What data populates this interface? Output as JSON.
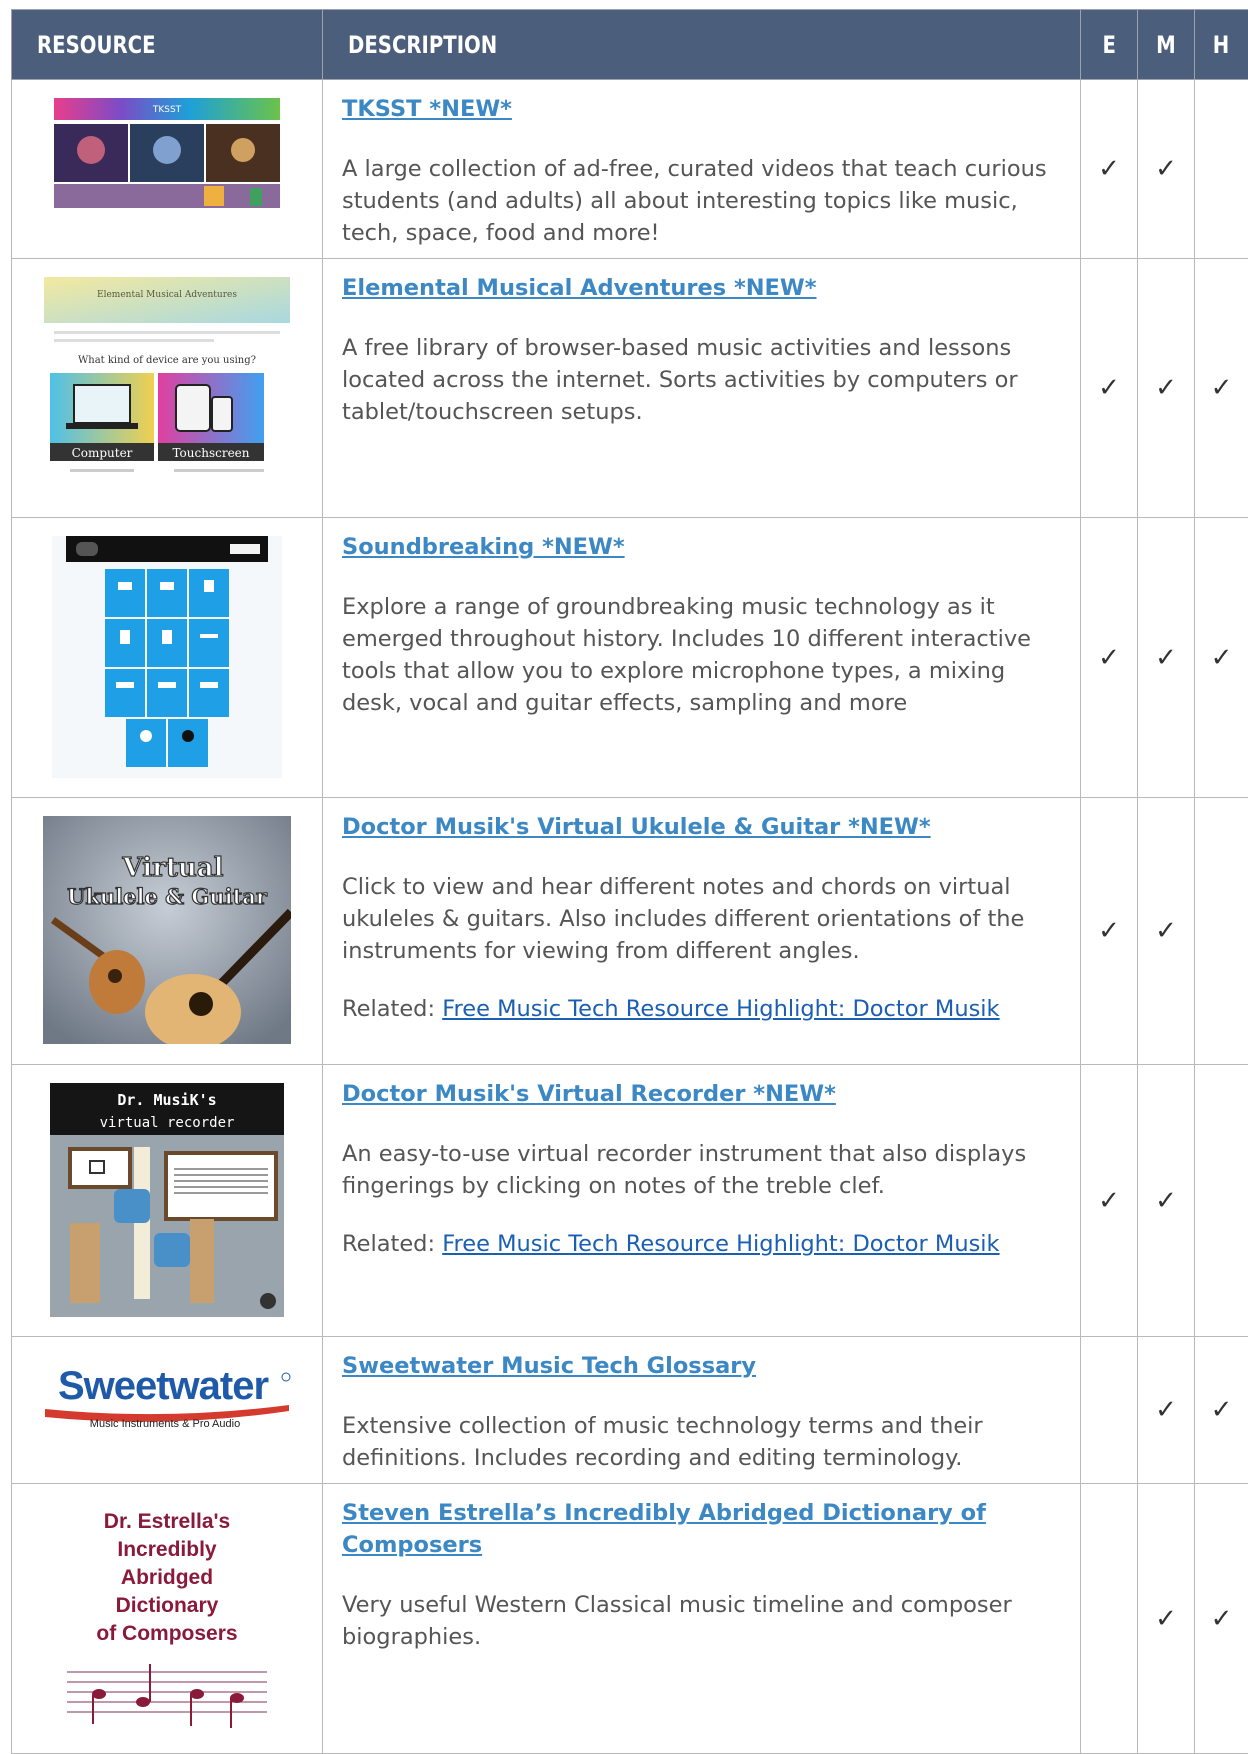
{
  "header": {
    "resource": "RESOURCE",
    "description": "DESCRIPTION",
    "e": "E",
    "m": "M",
    "h": "H"
  },
  "check_glyph": "✓",
  "colors": {
    "header_bg": "#4b5f7c",
    "link": "#3c88c4",
    "related_link": "#1a5fb4",
    "body_text": "#555555"
  },
  "rows": [
    {
      "title": "TKSST *NEW*",
      "description": "A large collection of ad-free, curated videos that teach curious students (and adults) all about interesting topics like music, tech, space, food and more!",
      "thumb_label": "TKSST",
      "thumb_icon": "tksst-thumbnail",
      "e": true,
      "m": true,
      "h": false
    },
    {
      "title": "Elemental Musical Adventures *NEW*",
      "description": "A free library of browser-based music activities and lessons located across the internet. Sorts activities by computers or tablet/touchscreen setups.",
      "thumb_label": "Elemental Musical Adventures",
      "thumb_question": "What kind of device are you using?",
      "thumb_btn1": "Computer",
      "thumb_btn2": "Touchscreen",
      "thumb_icon": "elemental-thumbnail",
      "e": true,
      "m": true,
      "h": true
    },
    {
      "title": "Soundbreaking *NEW*",
      "description": "Explore a range of groundbreaking music technology as it emerged throughout history. Includes 10 different interactive tools that allow you to explore microphone types, a mixing desk, vocal and guitar effects, sampling and more",
      "thumb_icon": "soundbreaking-thumbnail",
      "e": true,
      "m": true,
      "h": true
    },
    {
      "title": "Doctor Musik's Virtual Ukulele & Guitar *NEW*",
      "description": "Click to view and hear different notes and chords on virtual ukuleles & guitars. Also includes different orientations of the instruments for viewing from different angles.",
      "related_prefix": "Related: ",
      "related_link": "Free Music Tech Resource Highlight: Doctor Musik",
      "thumb_line1": "Virtual",
      "thumb_line2": "Ukulele & Guitar",
      "thumb_icon": "ukulele-guitar-thumbnail",
      "e": true,
      "m": true,
      "h": false
    },
    {
      "title": "Doctor Musik's Virtual Recorder *NEW*",
      "description": "An easy-to-use virtual recorder instrument that also displays fingerings by clicking on notes of the treble clef.",
      "related_prefix": "Related: ",
      "related_link": "Free Music Tech Resource Highlight: Doctor Musik",
      "thumb_line1": "Dr. MusiK's",
      "thumb_line2": "virtual recorder",
      "thumb_icon": "recorder-thumbnail",
      "e": true,
      "m": true,
      "h": false
    },
    {
      "title": "Sweetwater Music Tech Glossary",
      "description": "Extensive collection of music technology terms and their definitions. Includes recording and editing terminology.",
      "thumb_line1": "Sweetwater",
      "thumb_line2": "Music Instruments & Pro Audio",
      "thumb_icon": "sweetwater-logo",
      "e": false,
      "m": true,
      "h": true
    },
    {
      "title": "Steven Estrella’s Incredibly Abridged Dictionary of Composers",
      "description": "Very useful Western Classical music timeline and composer biographies.",
      "thumb_line1": "Dr. Estrella's",
      "thumb_line2": "Incredibly",
      "thumb_line3": "Abridged",
      "thumb_line4": "Dictionary",
      "thumb_line5": "of Composers",
      "thumb_icon": "estrella-thumbnail",
      "e": false,
      "m": true,
      "h": true
    }
  ]
}
